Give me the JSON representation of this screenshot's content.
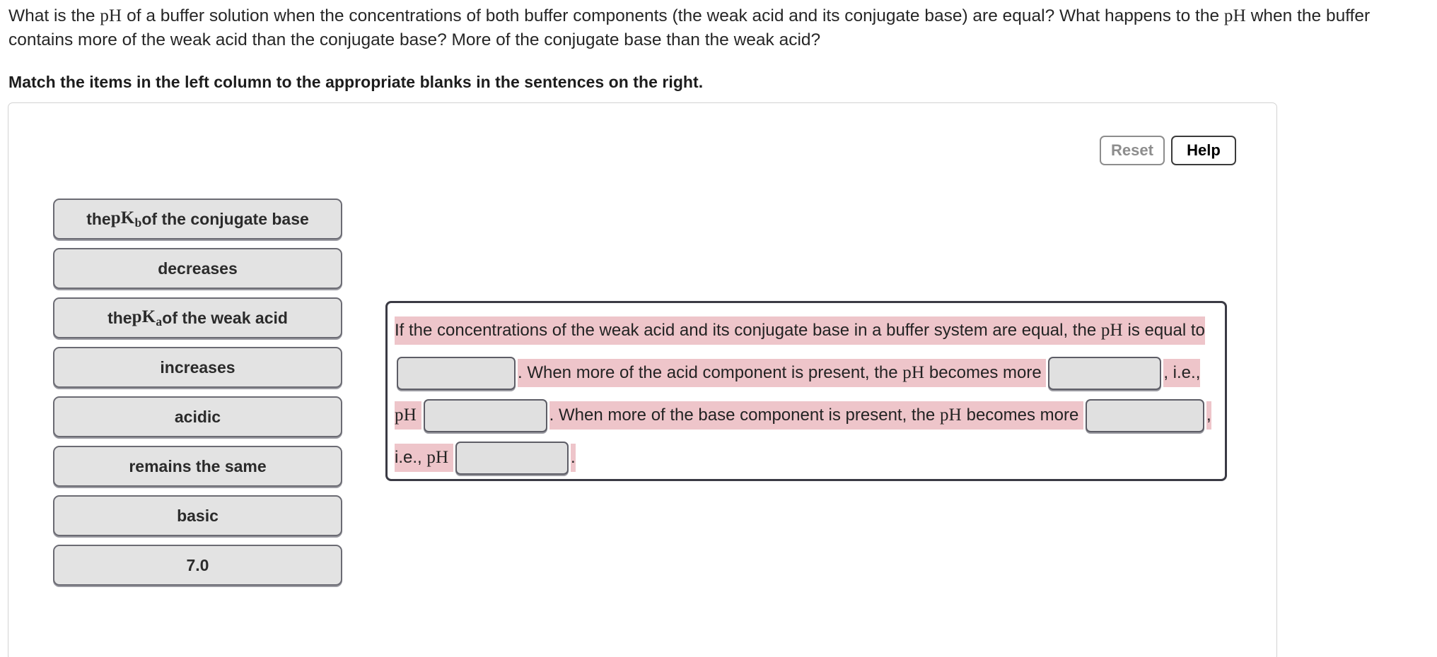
{
  "question": {
    "line1_a": "What is the ",
    "ph_1": "pH",
    "line1_b": " of a buffer solution when the concentrations of both buffer components (the weak acid and its conjugate base) are equal? What happens to the ",
    "ph_2": "pH",
    "line1_c": " when the buffer",
    "line2": "contains more of the weak acid than the conjugate base? More of the conjugate base than the weak acid?",
    "instruction": "Match the items in the left column to the appropriate blanks in the sentences on the right."
  },
  "toolbar": {
    "reset_label": "Reset",
    "help_label": "Help",
    "reset_disabled": true
  },
  "choices": [
    {
      "parts": [
        "the ",
        "pK",
        "b",
        " of the conjugate base"
      ],
      "type": "math",
      "label": "the pKb of the conjugate base"
    },
    {
      "label": "decreases",
      "type": "plain"
    },
    {
      "parts": [
        "the ",
        "pK",
        "a",
        " of the weak acid"
      ],
      "type": "math",
      "label": "the pKa of the weak acid"
    },
    {
      "label": "increases",
      "type": "plain"
    },
    {
      "label": "acidic",
      "type": "plain"
    },
    {
      "label": "remains the same",
      "type": "plain"
    },
    {
      "label": "basic",
      "type": "plain"
    },
    {
      "label": "7.0",
      "type": "plain"
    }
  ],
  "sentence": {
    "seg1": "If the concentrations of the weak acid and its conjugate base in a buffer system are equal, the ",
    "ph_a": "pH",
    "seg2": " is equal to ",
    "blank1": "",
    "seg3": ". When more of the acid component is present, the ",
    "ph_b": "pH",
    "seg4": " becomes more ",
    "blank2": "",
    "seg5": ", i.e., ",
    "ph_c": "pH",
    "seg6": " ",
    "blank3": "",
    "seg7": ". When more of the base component is present, the ",
    "ph_d": "pH",
    "seg8": " becomes more ",
    "blank4": "",
    "seg9": ", i.e., ",
    "ph_e": "pH",
    "seg10": " ",
    "blank5": "",
    "seg11": "."
  },
  "colors": {
    "highlight": "#eec5ca",
    "tile_fill": "#e3e3e3",
    "tile_border": "#6b6b73",
    "panel_border": "#3a3a44",
    "disabled_text": "#8d8d8d"
  }
}
